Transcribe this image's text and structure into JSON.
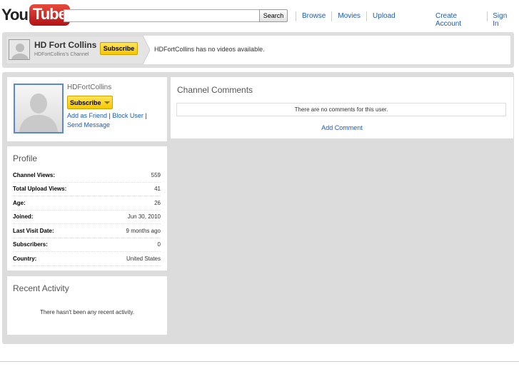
{
  "header": {
    "logo_you": "You",
    "logo_tube": "Tube",
    "search_placeholder": "",
    "search_button": "Search",
    "nav": [
      "Browse",
      "Movies",
      "Upload"
    ],
    "account": [
      "Create Account",
      "Sign In"
    ]
  },
  "channel_bar": {
    "name": "HD Fort Collins",
    "subtitle": "HDFortCollins's Channel",
    "subscribe": "Subscribe",
    "no_videos": "HDFortCollins has no videos available."
  },
  "profile_card": {
    "username": "HDFortCollins",
    "subscribe": "Subscribe",
    "add_friend": "Add as Friend",
    "block_user": "Block User",
    "send_message": "Send Message",
    "separator": "|"
  },
  "profile": {
    "title": "Profile",
    "rows": [
      {
        "label": "Channel Views:",
        "value": "559"
      },
      {
        "label": "Total Upload Views:",
        "value": "41"
      },
      {
        "label": "Age:",
        "value": "26"
      },
      {
        "label": "Joined:",
        "value": "Jun 30, 2010"
      },
      {
        "label": "Last Visit Date:",
        "value": "9 months ago"
      },
      {
        "label": "Subscribers:",
        "value": "0"
      },
      {
        "label": "Country:",
        "value": "United States"
      }
    ]
  },
  "activity": {
    "title": "Recent Activity",
    "empty": "There hasn't been any recent activity."
  },
  "comments": {
    "title": "Channel Comments",
    "empty": "There are no comments for this user.",
    "add": "Add Comment"
  },
  "colors": {
    "link": "#1a5bb5",
    "subscribe": "#f6c700",
    "logo_red": "#c4302b",
    "photo_border": "#5b87d8"
  }
}
